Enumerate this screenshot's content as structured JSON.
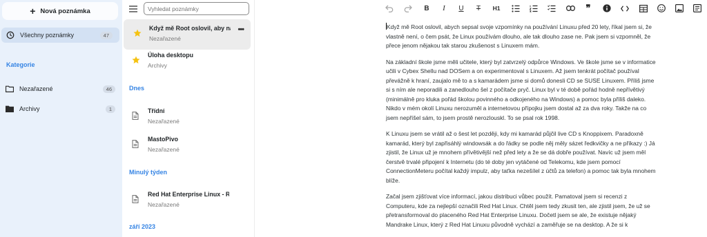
{
  "sidebar": {
    "new_note_label": "Nová poznámka",
    "all_notes": {
      "label": "Všechny poznámky",
      "count": "47"
    },
    "categories_heading": "Kategorie",
    "categories": [
      {
        "label": "Nezařazené",
        "count": "46"
      },
      {
        "label": "Archivy",
        "count": "1"
      }
    ]
  },
  "notelist": {
    "search_placeholder": "Vyhledat poznámky",
    "pinned": [
      {
        "title": "Když mě Root oslovil, aby napsal…",
        "category": "Nezařazené",
        "icon": "star-icon"
      },
      {
        "title": "Úloha desktopu",
        "category": "Archivy",
        "icon": "star-icon"
      }
    ],
    "groups": [
      {
        "label": "Dnes"
      },
      {
        "label": "Minulý týden"
      },
      {
        "label": "září 2023"
      }
    ],
    "notes": [
      {
        "title": "Třídní",
        "category": "Nezařazené",
        "icon": "document-icon"
      },
      {
        "title": "MastoPivo",
        "category": "Nezařazené",
        "icon": "document-icon"
      },
      {
        "title": "Red Hat Enterprise Linux - RHEL",
        "category": "Nezařazené",
        "icon": "document-icon"
      }
    ],
    "more_label": "•••"
  },
  "toolbar": {
    "heading_label": "H1",
    "icons": [
      "undo-icon",
      "redo-icon",
      "bold-icon",
      "italic-icon",
      "underline-icon",
      "strikethrough-icon",
      "heading-icon",
      "bullet-list-icon",
      "numbered-list-icon",
      "checklist-icon",
      "link-icon",
      "quote-icon",
      "info-icon",
      "code-icon",
      "table-icon",
      "emoji-icon",
      "image-icon",
      "preview-icon"
    ]
  },
  "editor": {
    "paragraphs": [
      "Když mě Root oslovil, abych sepsal svoje vzpomínky na používání Linuxu před 20 lety, říkal jsem si, že vlastně není, o čem psát, že Linux používám dlouho, ale tak dlouho zase ne. Pak jsem si vzpomněl, že přece jenom nějakou tak starou zkušenost s Linuxem mám.",
      "Na základní škole jsme měli učitele, který byl zatvrzelý odpůrce Windows. Ve škole jsme se v informatice učili v Cybex Shellu nad DOSem a on experimentoval s Linuxem. Až jsem tenkrát počítač používal převážně k hraní, zaujalo mě to a s kamarádem jsme si domů donesli CD se SUSE Linuxem. Příliš jsme si s ním ale neporadili a zanedlouho šel z počítače pryč. Linux byl v té době pořád hodně nepřívětivý (minimálně pro kluka pořád školou povinného a odkojeného na Windows) a pomoc byla příliš daleko. Nikdo v mém okolí Linuxu nerozuměl a internetovou přípojku jsem dostal až za dva roky. Takže na co jsem nepříšel sám, to jsem prostě nerozlouskl. To se psal rok 1998.",
      "K Linuxu jsem se vrátil až o šest let později, kdy mi kamarád půjčil live CD s Knoppixem. Paradoxně kamarád, který byl zapřisáhlý windowsák a do řádky se podle něj měly sázet ředkvičky a ne příkazy :) Já zjistil, že Linux už je mnohem přívětivější než před lety a že se dá dobře používat. Navíc už jsem měl čerstvě trvalé připojení k Internetu (do té doby jen vytáčené od Telekomu, kde jsem pomocí ConnectionMeteru počítal každý impulz, aby taťka nezešílel z účtů za telefon) a pomoc tak byla mnohem blíže.",
      "Začal jsem zjišťovat více informací, jakou distribuci vůbec použít. Pamatoval jsem si recenzi z Computeru, kde za nejlepší označili Red Hat Linux. Chtěl jsem tedy zkusit ten, ale zjistil jsem, že už se přetransformoval do placeného Red Hat Enterprise Linuxu. Dočetl jsem se ale, že existuje nějaký Mandrake Linux, který z Red Hat Linuxu původně vychází a zaměřuje se na desktop. A že si k"
    ]
  },
  "colors": {
    "accent": "#3584e4",
    "sidebar_bg": "#e9f1fb",
    "star": "#f5c211"
  }
}
